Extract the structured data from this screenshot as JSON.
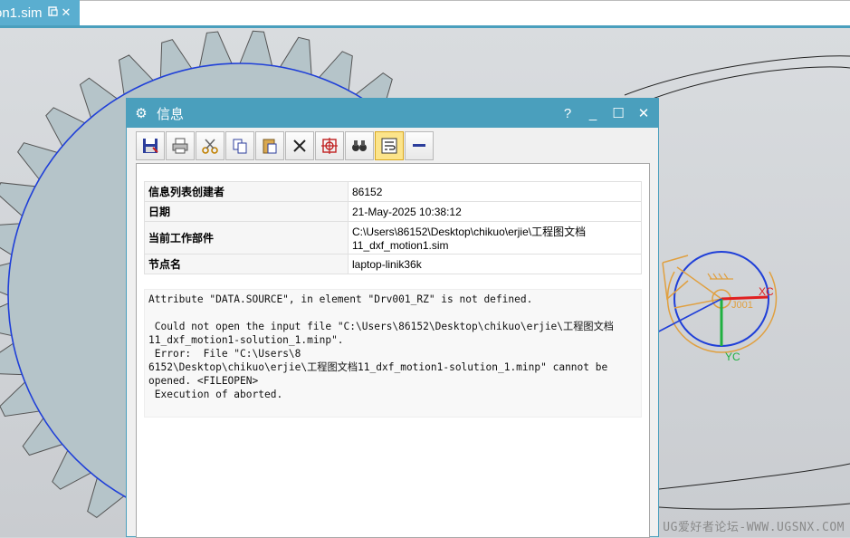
{
  "tab": {
    "title": "on1.sim",
    "pin_icon": "pin-icon",
    "close_glyph": "✕"
  },
  "dialog": {
    "title": "信息",
    "help": "?",
    "minimize": "_",
    "maximize": "☐",
    "close": "✕",
    "toolbar": [
      "save-icon",
      "print-icon",
      "cut-icon",
      "copy-icon",
      "paste-icon",
      "delete-icon",
      "target-icon",
      "binoculars-icon",
      "wrap-text-icon",
      "minus-icon"
    ],
    "info_rows": [
      {
        "key": "信息列表创建者",
        "value": "86152"
      },
      {
        "key": "日期",
        "value": "21-May-2025 10:38:12"
      },
      {
        "key": "当前工作部件",
        "value": "C:\\Users\\86152\\Desktop\\chikuo\\erjie\\工程图文档\n11_dxf_motion1.sim"
      },
      {
        "key": "节点名",
        "value": "laptop-linik36k"
      }
    ],
    "log_text": "Attribute \"DATA.SOURCE\", in element \"Drv001_RZ\" is not defined.\n\n Could not open the input file \"C:\\Users\\86152\\Desktop\\chikuo\\erjie\\工程图文档\n11_dxf_motion1-solution_1.minp\".\n Error:  File \"C:\\Users\\8\n6152\\Desktop\\chikuo\\erjie\\工程图文档11_dxf_motion1-solution_1.minp\" cannot be\nopened. <FILEOPEN>\n Execution of aborted."
  },
  "viewport": {
    "labels": {
      "xc": "XC",
      "yc": "YC",
      "node": "J001"
    },
    "watermark": "UG爱好者论坛-WWW.UGSNX.COM"
  },
  "colors": {
    "accent": "#4a9fbd",
    "gear_outline": "#1f3fd8",
    "orange": "#e0a040",
    "red": "#e02020",
    "green": "#20b040"
  }
}
